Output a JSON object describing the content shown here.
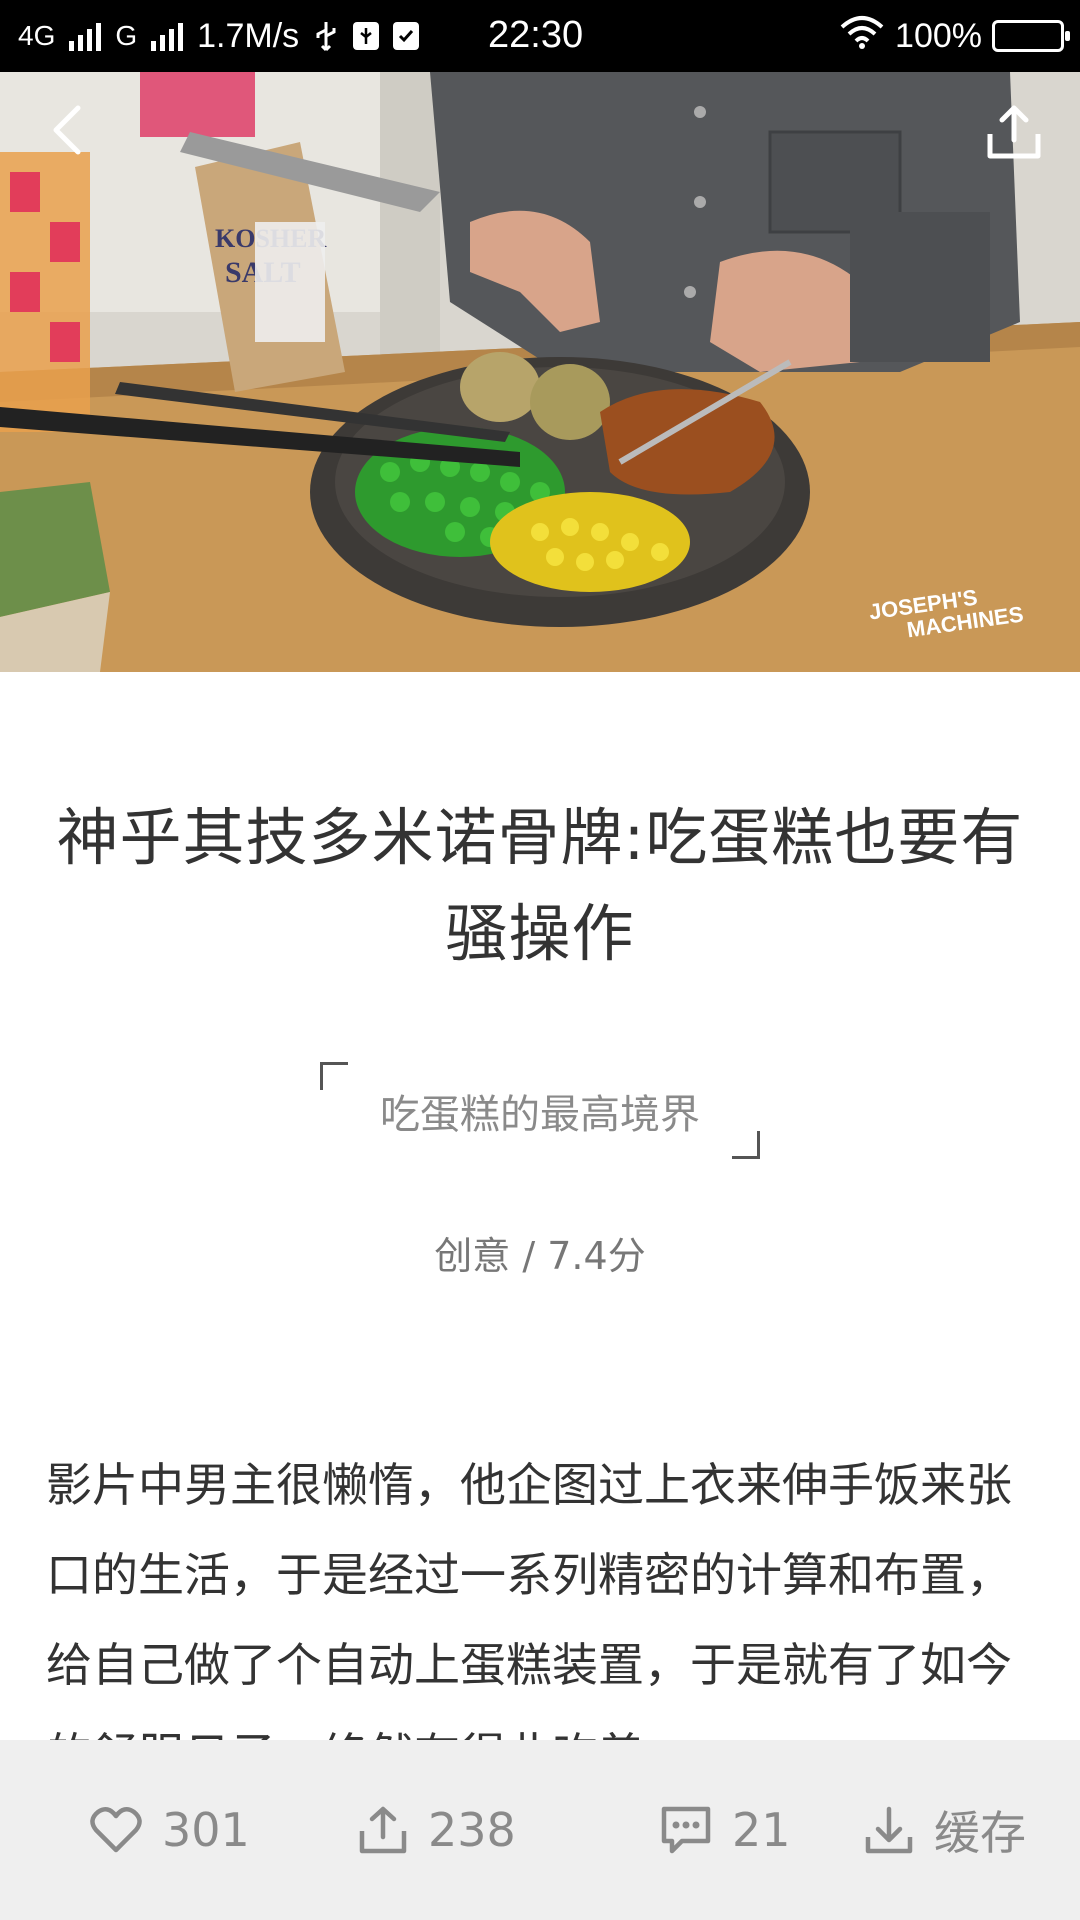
{
  "status_bar": {
    "network_1": "4G",
    "network_2": "G",
    "speed": "1.7M/s",
    "time": "22:30",
    "battery": "100%",
    "battery_level": 1.0,
    "icons": [
      "signal-icon",
      "usb-icon",
      "usb-debug-icon",
      "clipboard-check-icon",
      "wifi-icon",
      "battery-icon"
    ]
  },
  "hero": {
    "watermark_line1": "JOSEPH'S",
    "watermark_line2": "MACHINES",
    "salt_label_1": "KOSHER",
    "salt_label_2": "SALT",
    "back_icon": "chevron-left-icon",
    "share_icon": "share-icon"
  },
  "article": {
    "title": "神乎其技多米诺骨牌:吃蛋糕也要有骚操作",
    "quote": "吃蛋糕的最高境界",
    "meta": "创意 / 7.4分",
    "body": "影片中男主很懒惰，他企图过上衣来伸手饭来张口的生活，于是经过一系列精密的计算和布置，给自己做了个自动上蛋糕装置，于是就有了如今的舒服日子，终然有得此吃着"
  },
  "actions": {
    "like_count": "301",
    "share_count": "238",
    "comment_count": "21",
    "download_label": "缓存"
  },
  "colors": {
    "status_bar_bg": "#000000",
    "action_bar_bg": "#efefef",
    "action_text": "#8a8a8a",
    "title_text": "#333333"
  }
}
